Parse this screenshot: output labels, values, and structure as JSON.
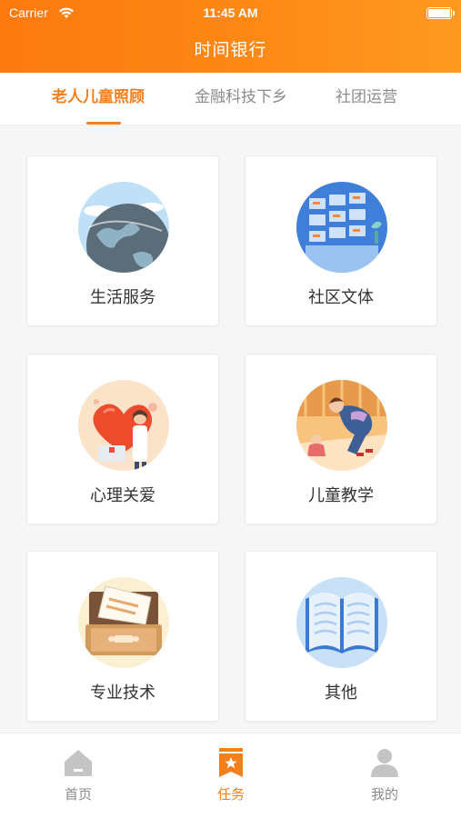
{
  "status_bar": {
    "carrier": "Carrier",
    "time": "11:45 AM"
  },
  "header": {
    "title": "时间银行"
  },
  "tabs": [
    {
      "label": "老人儿童照顾",
      "active": true
    },
    {
      "label": "金融科技下乡",
      "active": false
    },
    {
      "label": "社团运营",
      "active": false
    }
  ],
  "categories": [
    {
      "label": "生活服务",
      "icon": "globe-icon"
    },
    {
      "label": "社区文体",
      "icon": "calendar-board-icon"
    },
    {
      "label": "心理关爱",
      "icon": "heart-doctor-icon"
    },
    {
      "label": "儿童教学",
      "icon": "children-reading-icon"
    },
    {
      "label": "专业技术",
      "icon": "file-drawer-icon"
    },
    {
      "label": "其他",
      "icon": "open-book-icon"
    }
  ],
  "bottom_nav": [
    {
      "label": "首页",
      "icon": "home-icon",
      "active": false
    },
    {
      "label": "任务",
      "icon": "task-bookmark-icon",
      "active": true
    },
    {
      "label": "我的",
      "icon": "user-icon",
      "active": false
    }
  ],
  "colors": {
    "accent": "#f3801c",
    "header_start": "#fc7a0e",
    "header_end": "#fe9a22"
  }
}
